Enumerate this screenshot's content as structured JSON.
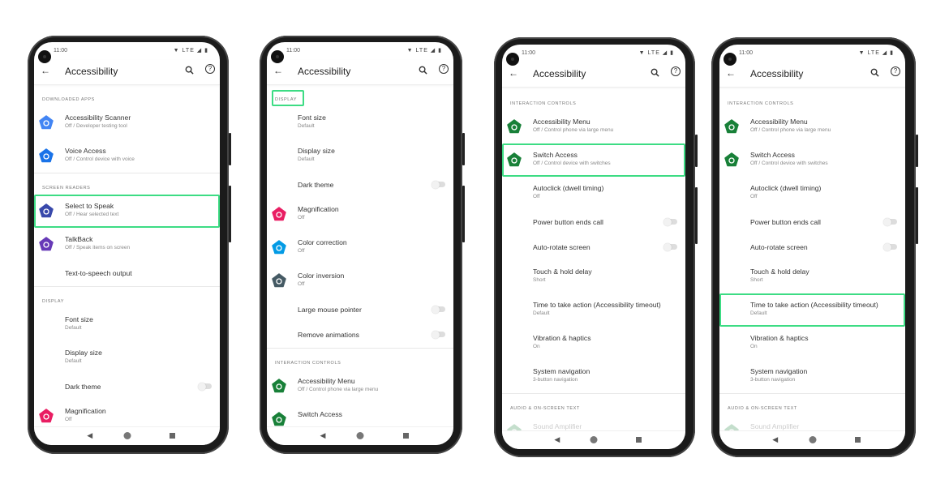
{
  "colors": {
    "highlight": "#3ddc84"
  },
  "phones": [
    {
      "status_time": "11:00",
      "status_icons": "▼ LTE ◢ ▮",
      "title": "Accessibility",
      "back_icon": "arrow-left-icon",
      "search_icon": "search-icon",
      "help_icon": "help-icon",
      "help_glyph": "?",
      "nav": {
        "back": "◀"
      },
      "blocks": [
        {
          "type": "section",
          "label": "DOWNLOADED APPS"
        },
        {
          "type": "item",
          "title": "Accessibility Scanner",
          "subtitle": "Off / Developer testing tool",
          "icon": "accessibility-scanner-icon",
          "icon_color": "#4285f4"
        },
        {
          "type": "item",
          "title": "Voice Access",
          "subtitle": "Off / Control device with voice",
          "icon": "voice-access-icon",
          "icon_color": "#1a73e8"
        },
        {
          "type": "divider"
        },
        {
          "type": "section",
          "label": "SCREEN READERS"
        },
        {
          "type": "item",
          "title": "Select to Speak",
          "subtitle": "Off / Hear selected text",
          "icon": "select-to-speak-icon",
          "icon_color": "#3949ab",
          "highlight": true
        },
        {
          "type": "item",
          "title": "TalkBack",
          "subtitle": "Off / Speak items on screen",
          "icon": "talkback-icon",
          "icon_color": "#673ab7"
        },
        {
          "type": "item",
          "title": "Text-to-speech output"
        },
        {
          "type": "divider"
        },
        {
          "type": "section",
          "label": "DISPLAY"
        },
        {
          "type": "item",
          "title": "Font size",
          "subtitle": "Default"
        },
        {
          "type": "item",
          "title": "Display size",
          "subtitle": "Default"
        },
        {
          "type": "item",
          "title": "Dark theme",
          "toggle": false
        },
        {
          "type": "item",
          "title": "Magnification",
          "subtitle": "Off",
          "icon": "magnification-icon",
          "icon_color": "#e91e63"
        }
      ]
    },
    {
      "status_time": "11:00",
      "status_icons": "▼ LTE ◢ ▮",
      "title": "Accessibility",
      "back_icon": "arrow-left-icon",
      "search_icon": "search-icon",
      "help_icon": "help-icon",
      "help_glyph": "?",
      "nav": {
        "back": "◀"
      },
      "blocks": [
        {
          "type": "section",
          "label": "DISPLAY",
          "highlight": true
        },
        {
          "type": "item",
          "title": "Font size",
          "subtitle": "Default"
        },
        {
          "type": "item",
          "title": "Display size",
          "subtitle": "Default"
        },
        {
          "type": "item",
          "title": "Dark theme",
          "toggle": false
        },
        {
          "type": "item",
          "title": "Magnification",
          "subtitle": "Off",
          "icon": "magnification-icon",
          "icon_color": "#e91e63"
        },
        {
          "type": "item",
          "title": "Color correction",
          "subtitle": "Off",
          "icon": "color-correction-icon",
          "icon_color": "#039be5"
        },
        {
          "type": "item",
          "title": "Color inversion",
          "subtitle": "Off",
          "icon": "color-inversion-icon",
          "icon_color": "#455a64"
        },
        {
          "type": "item",
          "title": "Large mouse pointer",
          "toggle": false
        },
        {
          "type": "item",
          "title": "Remove animations",
          "toggle": false
        },
        {
          "type": "divider"
        },
        {
          "type": "section",
          "label": "INTERACTION CONTROLS"
        },
        {
          "type": "item",
          "title": "Accessibility Menu",
          "subtitle": "Off / Control phone via large menu",
          "icon": "accessibility-menu-icon",
          "icon_color": "#188038"
        },
        {
          "type": "item",
          "title": "Switch Access",
          "subtitle": "",
          "icon": "switch-access-icon",
          "icon_color": "#188038"
        }
      ]
    },
    {
      "status_time": "11:00",
      "status_icons": "▼ LTE ◢ ▮",
      "title": "Accessibility",
      "back_icon": "arrow-left-icon",
      "search_icon": "search-icon",
      "help_icon": "help-icon",
      "help_glyph": "?",
      "nav": {
        "back": "◀"
      },
      "blocks": [
        {
          "type": "section",
          "label": "INTERACTION CONTROLS"
        },
        {
          "type": "item",
          "title": "Accessibility Menu",
          "subtitle": "Off / Control phone via large menu",
          "icon": "accessibility-menu-icon",
          "icon_color": "#188038"
        },
        {
          "type": "item",
          "title": "Switch Access",
          "subtitle": "Off / Control device with switches",
          "icon": "switch-access-icon",
          "icon_color": "#188038",
          "highlight": true
        },
        {
          "type": "item",
          "title": "Autoclick (dwell timing)",
          "subtitle": "Off"
        },
        {
          "type": "item",
          "title": "Power button ends call",
          "toggle": false
        },
        {
          "type": "item",
          "title": "Auto-rotate screen",
          "toggle": false
        },
        {
          "type": "item",
          "title": "Touch & hold delay",
          "subtitle": "Short"
        },
        {
          "type": "item",
          "title": "Time to take action (Accessibility timeout)",
          "subtitle": "Default"
        },
        {
          "type": "item",
          "title": "Vibration & haptics",
          "subtitle": "On"
        },
        {
          "type": "item",
          "title": "System navigation",
          "subtitle": "3-button navigation"
        },
        {
          "type": "divider"
        },
        {
          "type": "section",
          "label": "AUDIO & ON-SCREEN TEXT"
        },
        {
          "type": "item",
          "title": "Sound Amplifier",
          "subtitle": "",
          "icon": "sound-amplifier-icon",
          "icon_color": "#188038",
          "faded": true
        }
      ]
    },
    {
      "status_time": "11:00",
      "status_icons": "▼ LTE ◢ ▮",
      "title": "Accessibility",
      "back_icon": "arrow-left-icon",
      "search_icon": "search-icon",
      "help_icon": "help-icon",
      "help_glyph": "?",
      "nav": {
        "back": "◀"
      },
      "blocks": [
        {
          "type": "section",
          "label": "INTERACTION CONTROLS"
        },
        {
          "type": "item",
          "title": "Accessibility Menu",
          "subtitle": "Off / Control phone via large menu",
          "icon": "accessibility-menu-icon",
          "icon_color": "#188038"
        },
        {
          "type": "item",
          "title": "Switch Access",
          "subtitle": "Off / Control device with switches",
          "icon": "switch-access-icon",
          "icon_color": "#188038"
        },
        {
          "type": "item",
          "title": "Autoclick (dwell timing)",
          "subtitle": "Off"
        },
        {
          "type": "item",
          "title": "Power button ends call",
          "toggle": false
        },
        {
          "type": "item",
          "title": "Auto-rotate screen",
          "toggle": false
        },
        {
          "type": "item",
          "title": "Touch & hold delay",
          "subtitle": "Short"
        },
        {
          "type": "item",
          "title": "Time to take action (Accessibility timeout)",
          "subtitle": "Default",
          "highlight": true
        },
        {
          "type": "item",
          "title": "Vibration & haptics",
          "subtitle": "On"
        },
        {
          "type": "item",
          "title": "System navigation",
          "subtitle": "3-button navigation"
        },
        {
          "type": "divider"
        },
        {
          "type": "section",
          "label": "AUDIO & ON-SCREEN TEXT"
        },
        {
          "type": "item",
          "title": "Sound Amplifier",
          "subtitle": "",
          "icon": "sound-amplifier-icon",
          "icon_color": "#188038",
          "faded": true
        }
      ]
    }
  ]
}
